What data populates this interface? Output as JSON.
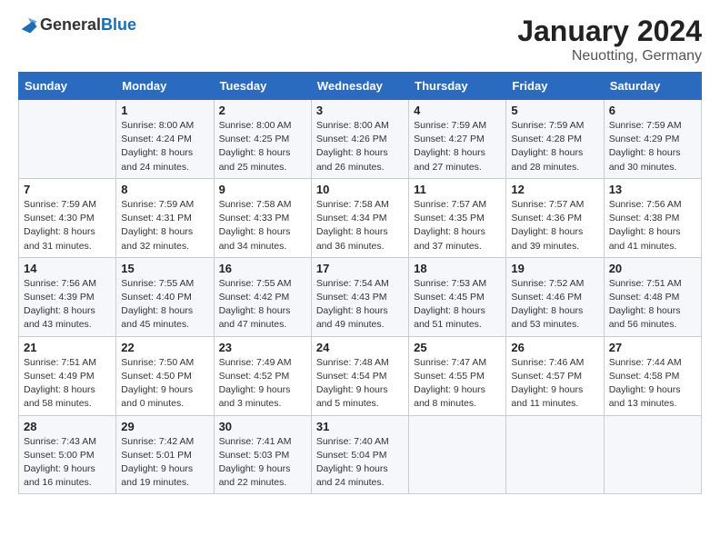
{
  "logo": {
    "text_general": "General",
    "text_blue": "Blue"
  },
  "title": "January 2024",
  "subtitle": "Neuotting, Germany",
  "weekdays": [
    "Sunday",
    "Monday",
    "Tuesday",
    "Wednesday",
    "Thursday",
    "Friday",
    "Saturday"
  ],
  "weeks": [
    [
      {
        "day": "",
        "sunrise": "",
        "sunset": "",
        "daylight": ""
      },
      {
        "day": "1",
        "sunrise": "Sunrise: 8:00 AM",
        "sunset": "Sunset: 4:24 PM",
        "daylight": "Daylight: 8 hours and 24 minutes."
      },
      {
        "day": "2",
        "sunrise": "Sunrise: 8:00 AM",
        "sunset": "Sunset: 4:25 PM",
        "daylight": "Daylight: 8 hours and 25 minutes."
      },
      {
        "day": "3",
        "sunrise": "Sunrise: 8:00 AM",
        "sunset": "Sunset: 4:26 PM",
        "daylight": "Daylight: 8 hours and 26 minutes."
      },
      {
        "day": "4",
        "sunrise": "Sunrise: 7:59 AM",
        "sunset": "Sunset: 4:27 PM",
        "daylight": "Daylight: 8 hours and 27 minutes."
      },
      {
        "day": "5",
        "sunrise": "Sunrise: 7:59 AM",
        "sunset": "Sunset: 4:28 PM",
        "daylight": "Daylight: 8 hours and 28 minutes."
      },
      {
        "day": "6",
        "sunrise": "Sunrise: 7:59 AM",
        "sunset": "Sunset: 4:29 PM",
        "daylight": "Daylight: 8 hours and 30 minutes."
      }
    ],
    [
      {
        "day": "7",
        "sunrise": "Sunrise: 7:59 AM",
        "sunset": "Sunset: 4:30 PM",
        "daylight": "Daylight: 8 hours and 31 minutes."
      },
      {
        "day": "8",
        "sunrise": "Sunrise: 7:59 AM",
        "sunset": "Sunset: 4:31 PM",
        "daylight": "Daylight: 8 hours and 32 minutes."
      },
      {
        "day": "9",
        "sunrise": "Sunrise: 7:58 AM",
        "sunset": "Sunset: 4:33 PM",
        "daylight": "Daylight: 8 hours and 34 minutes."
      },
      {
        "day": "10",
        "sunrise": "Sunrise: 7:58 AM",
        "sunset": "Sunset: 4:34 PM",
        "daylight": "Daylight: 8 hours and 36 minutes."
      },
      {
        "day": "11",
        "sunrise": "Sunrise: 7:57 AM",
        "sunset": "Sunset: 4:35 PM",
        "daylight": "Daylight: 8 hours and 37 minutes."
      },
      {
        "day": "12",
        "sunrise": "Sunrise: 7:57 AM",
        "sunset": "Sunset: 4:36 PM",
        "daylight": "Daylight: 8 hours and 39 minutes."
      },
      {
        "day": "13",
        "sunrise": "Sunrise: 7:56 AM",
        "sunset": "Sunset: 4:38 PM",
        "daylight": "Daylight: 8 hours and 41 minutes."
      }
    ],
    [
      {
        "day": "14",
        "sunrise": "Sunrise: 7:56 AM",
        "sunset": "Sunset: 4:39 PM",
        "daylight": "Daylight: 8 hours and 43 minutes."
      },
      {
        "day": "15",
        "sunrise": "Sunrise: 7:55 AM",
        "sunset": "Sunset: 4:40 PM",
        "daylight": "Daylight: 8 hours and 45 minutes."
      },
      {
        "day": "16",
        "sunrise": "Sunrise: 7:55 AM",
        "sunset": "Sunset: 4:42 PM",
        "daylight": "Daylight: 8 hours and 47 minutes."
      },
      {
        "day": "17",
        "sunrise": "Sunrise: 7:54 AM",
        "sunset": "Sunset: 4:43 PM",
        "daylight": "Daylight: 8 hours and 49 minutes."
      },
      {
        "day": "18",
        "sunrise": "Sunrise: 7:53 AM",
        "sunset": "Sunset: 4:45 PM",
        "daylight": "Daylight: 8 hours and 51 minutes."
      },
      {
        "day": "19",
        "sunrise": "Sunrise: 7:52 AM",
        "sunset": "Sunset: 4:46 PM",
        "daylight": "Daylight: 8 hours and 53 minutes."
      },
      {
        "day": "20",
        "sunrise": "Sunrise: 7:51 AM",
        "sunset": "Sunset: 4:48 PM",
        "daylight": "Daylight: 8 hours and 56 minutes."
      }
    ],
    [
      {
        "day": "21",
        "sunrise": "Sunrise: 7:51 AM",
        "sunset": "Sunset: 4:49 PM",
        "daylight": "Daylight: 8 hours and 58 minutes."
      },
      {
        "day": "22",
        "sunrise": "Sunrise: 7:50 AM",
        "sunset": "Sunset: 4:50 PM",
        "daylight": "Daylight: 9 hours and 0 minutes."
      },
      {
        "day": "23",
        "sunrise": "Sunrise: 7:49 AM",
        "sunset": "Sunset: 4:52 PM",
        "daylight": "Daylight: 9 hours and 3 minutes."
      },
      {
        "day": "24",
        "sunrise": "Sunrise: 7:48 AM",
        "sunset": "Sunset: 4:54 PM",
        "daylight": "Daylight: 9 hours and 5 minutes."
      },
      {
        "day": "25",
        "sunrise": "Sunrise: 7:47 AM",
        "sunset": "Sunset: 4:55 PM",
        "daylight": "Daylight: 9 hours and 8 minutes."
      },
      {
        "day": "26",
        "sunrise": "Sunrise: 7:46 AM",
        "sunset": "Sunset: 4:57 PM",
        "daylight": "Daylight: 9 hours and 11 minutes."
      },
      {
        "day": "27",
        "sunrise": "Sunrise: 7:44 AM",
        "sunset": "Sunset: 4:58 PM",
        "daylight": "Daylight: 9 hours and 13 minutes."
      }
    ],
    [
      {
        "day": "28",
        "sunrise": "Sunrise: 7:43 AM",
        "sunset": "Sunset: 5:00 PM",
        "daylight": "Daylight: 9 hours and 16 minutes."
      },
      {
        "day": "29",
        "sunrise": "Sunrise: 7:42 AM",
        "sunset": "Sunset: 5:01 PM",
        "daylight": "Daylight: 9 hours and 19 minutes."
      },
      {
        "day": "30",
        "sunrise": "Sunrise: 7:41 AM",
        "sunset": "Sunset: 5:03 PM",
        "daylight": "Daylight: 9 hours and 22 minutes."
      },
      {
        "day": "31",
        "sunrise": "Sunrise: 7:40 AM",
        "sunset": "Sunset: 5:04 PM",
        "daylight": "Daylight: 9 hours and 24 minutes."
      },
      {
        "day": "",
        "sunrise": "",
        "sunset": "",
        "daylight": ""
      },
      {
        "day": "",
        "sunrise": "",
        "sunset": "",
        "daylight": ""
      },
      {
        "day": "",
        "sunrise": "",
        "sunset": "",
        "daylight": ""
      }
    ]
  ]
}
